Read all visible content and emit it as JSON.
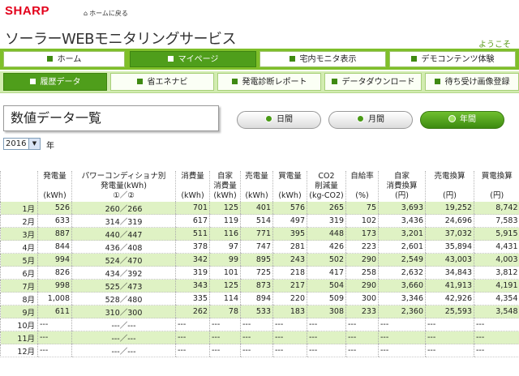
{
  "header": {
    "logo": "SHARP",
    "home_link": "ホームに戻る",
    "site_title": "ソーラーWEBモニタリングサービス",
    "welcome": "ようこそ"
  },
  "nav_main": [
    {
      "label": "ホーム",
      "active": false
    },
    {
      "label": "マイページ",
      "active": true
    },
    {
      "label": "宅内モニタ表示",
      "active": false
    },
    {
      "label": "デモコンテンツ体験",
      "active": false
    }
  ],
  "nav_sub": [
    {
      "label": "履歴データ",
      "active": true
    },
    {
      "label": "省エネナビ",
      "active": false
    },
    {
      "label": "発電診断レポート",
      "active": false
    },
    {
      "label": "データダウンロード",
      "active": false
    },
    {
      "label": "待ち受け画像登録",
      "active": false
    }
  ],
  "section_title": "数値データ一覧",
  "period_buttons": [
    {
      "label": "日間",
      "active": false
    },
    {
      "label": "月間",
      "active": false
    },
    {
      "label": "年間",
      "active": true
    }
  ],
  "year_select": {
    "value": "2016",
    "unit": "年"
  },
  "table": {
    "headers": [
      {
        "l1": "",
        "l2": "",
        "l3": ""
      },
      {
        "l1": "発電量",
        "l2": "",
        "l3": "(kWh)"
      },
      {
        "l1": "パワーコンディショナ別",
        "l2": "発電量(kWh)",
        "l3": "①／②"
      },
      {
        "l1": "消費量",
        "l2": "",
        "l3": "(kWh)"
      },
      {
        "l1": "自家",
        "l2": "消費量",
        "l3": "(kWh)"
      },
      {
        "l1": "売電量",
        "l2": "",
        "l3": "(kWh)"
      },
      {
        "l1": "買電量",
        "l2": "",
        "l3": "(kWh)"
      },
      {
        "l1": "CO2",
        "l2": "削減量",
        "l3": "(kg-CO2)"
      },
      {
        "l1": "自給率",
        "l2": "",
        "l3": "(%)"
      },
      {
        "l1": "自家",
        "l2": "消費換算",
        "l3": "(円)"
      },
      {
        "l1": "売電換算",
        "l2": "",
        "l3": "(円)"
      },
      {
        "l1": "買電換算",
        "l2": "",
        "l3": "(円)"
      }
    ],
    "rows": [
      [
        "1月",
        "526",
        "260／266",
        "701",
        "125",
        "401",
        "576",
        "265",
        "75",
        "3,693",
        "19,252",
        "8,742"
      ],
      [
        "2月",
        "633",
        "314／319",
        "617",
        "119",
        "514",
        "497",
        "319",
        "102",
        "3,436",
        "24,696",
        "7,583"
      ],
      [
        "3月",
        "887",
        "440／447",
        "511",
        "116",
        "771",
        "395",
        "448",
        "173",
        "3,201",
        "37,032",
        "5,915"
      ],
      [
        "4月",
        "844",
        "436／408",
        "378",
        "97",
        "747",
        "281",
        "426",
        "223",
        "2,601",
        "35,894",
        "4,431"
      ],
      [
        "5月",
        "994",
        "524／470",
        "342",
        "99",
        "895",
        "243",
        "502",
        "290",
        "2,549",
        "43,003",
        "4,003"
      ],
      [
        "6月",
        "826",
        "434／392",
        "319",
        "101",
        "725",
        "218",
        "417",
        "258",
        "2,632",
        "34,843",
        "3,812"
      ],
      [
        "7月",
        "998",
        "525／473",
        "343",
        "125",
        "873",
        "217",
        "504",
        "290",
        "3,660",
        "41,913",
        "4,191"
      ],
      [
        "8月",
        "1,008",
        "528／480",
        "335",
        "114",
        "894",
        "220",
        "509",
        "300",
        "3,346",
        "42,926",
        "4,354"
      ],
      [
        "9月",
        "611",
        "310／300",
        "262",
        "78",
        "533",
        "183",
        "308",
        "233",
        "2,360",
        "25,593",
        "3,548"
      ],
      [
        "10月",
        "---",
        "---／---",
        "---",
        "---",
        "---",
        "---",
        "---",
        "---",
        "---",
        "---",
        "---"
      ],
      [
        "11月",
        "---",
        "---／---",
        "---",
        "---",
        "---",
        "---",
        "---",
        "---",
        "---",
        "---",
        "---"
      ],
      [
        "12月",
        "---",
        "---／---",
        "---",
        "---",
        "---",
        "---",
        "---",
        "---",
        "---",
        "---",
        "---"
      ]
    ]
  }
}
